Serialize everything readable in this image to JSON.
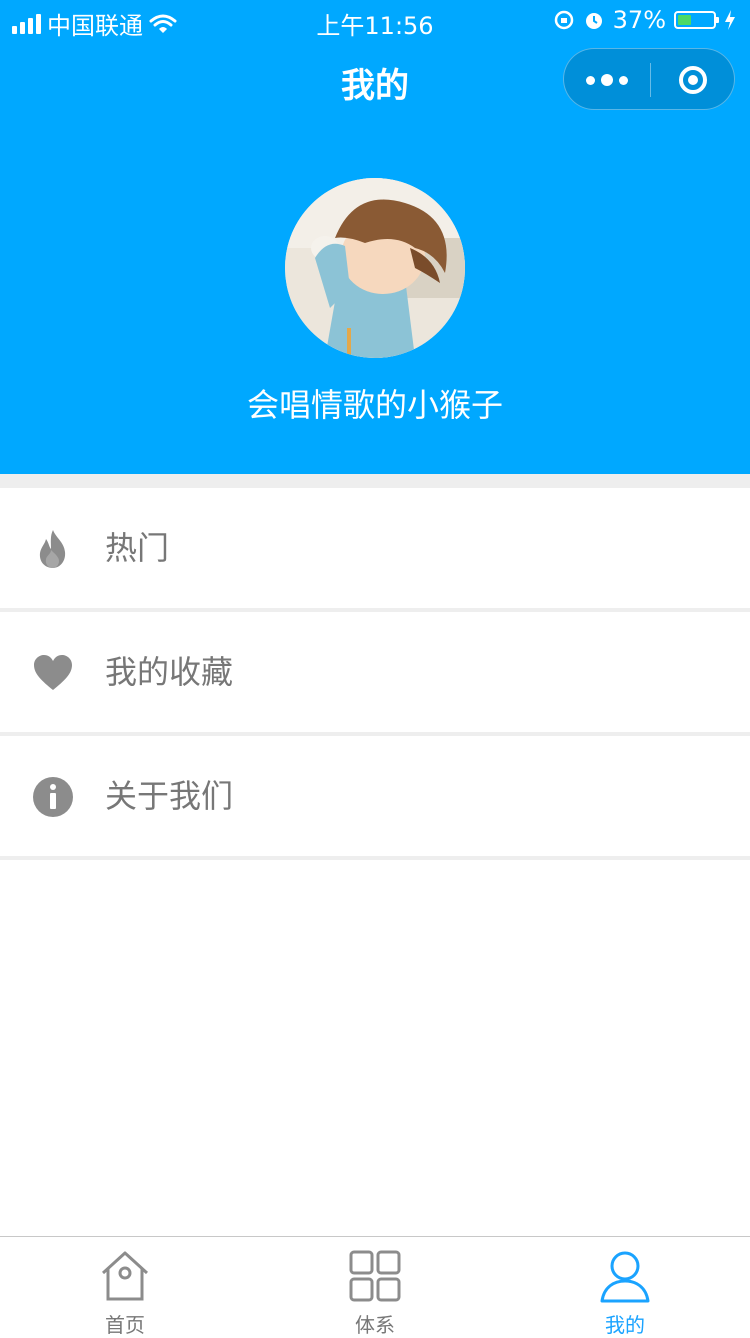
{
  "status_bar": {
    "carrier": "中国联通",
    "time": "上午11:56",
    "battery": "37%",
    "battery_level": 0.37
  },
  "navbar": {
    "title": "我的",
    "capsule_icons": [
      "more-icon",
      "close-target-icon"
    ]
  },
  "profile": {
    "username": "会唱情歌的小猴子"
  },
  "menu": {
    "items": [
      {
        "label": "热门",
        "icon": "fire-icon"
      },
      {
        "label": "我的收藏",
        "icon": "heart-icon"
      },
      {
        "label": "关于我们",
        "icon": "info-icon"
      }
    ]
  },
  "tabbar": {
    "tabs": [
      {
        "label": "首页",
        "icon": "home-icon",
        "active": false
      },
      {
        "label": "体系",
        "icon": "grid-icon",
        "active": false
      },
      {
        "label": "我的",
        "icon": "person-icon",
        "active": true
      }
    ]
  },
  "colors": {
    "primary": "#00a8ff",
    "tab_active": "#1aa3ff",
    "text_gray": "#777777",
    "divider": "#eeeeee"
  }
}
